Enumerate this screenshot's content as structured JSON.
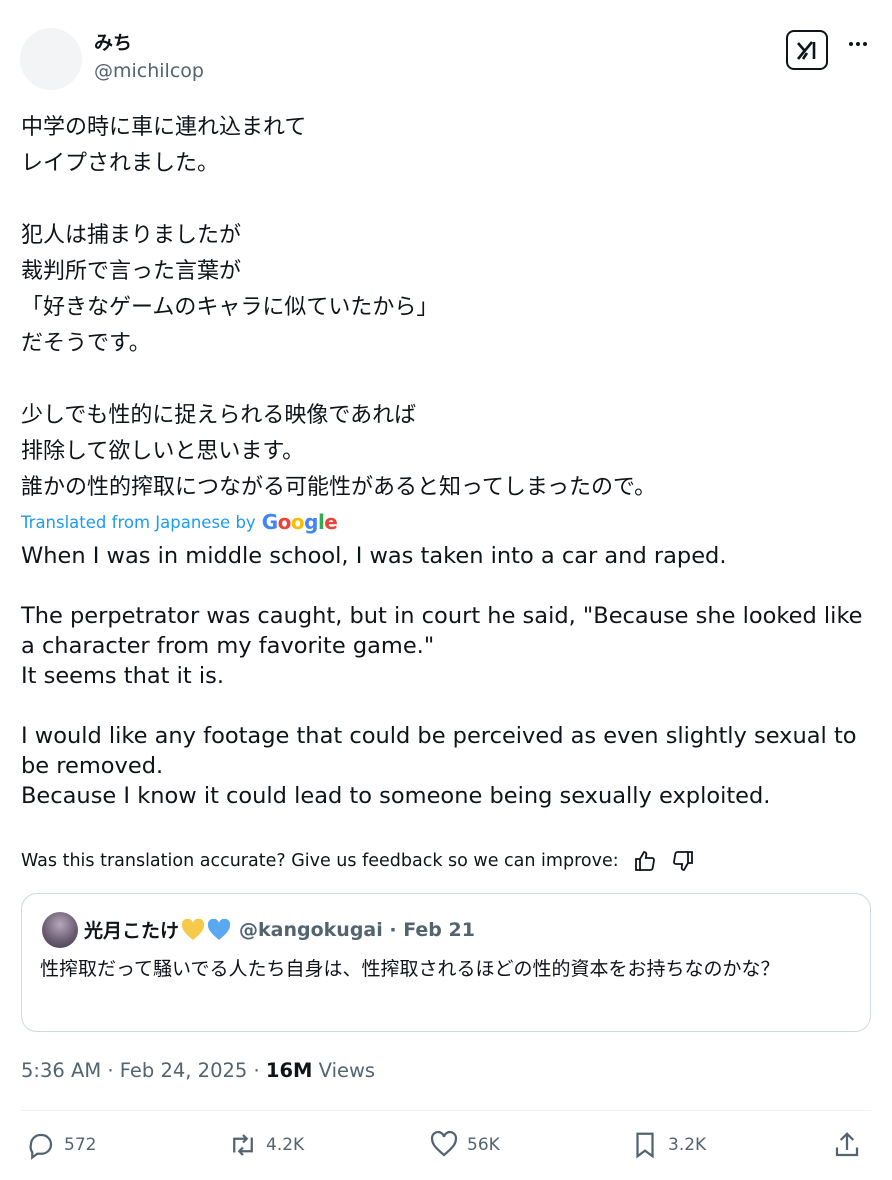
{
  "author": {
    "name": "みち",
    "handle": "@michilcop"
  },
  "icons": {
    "grok": "grok-icon",
    "more": "more-icon"
  },
  "tweet": {
    "jp_text": "中学の時に車に連れ込まれて\nレイプされました。\n\n犯人は捕まりましたが\n裁判所で言った言葉が\n「好きなゲームのキャラに似ていたから」\nだそうです。\n\n少しでも性的に捉えられる映像であれば\n排除して欲しいと思います。\n誰かの性的搾取につながる可能性があると知ってしまったので。",
    "translated_label": "Translated from Japanese by",
    "translator": "Google",
    "en_text": "When I was in middle school, I was taken into a car and raped.\n\nThe perpetrator was caught, but in court he said, \"Because she looked like a character from my favorite game.\"\nIt seems that it is.\n\nI would like any footage that could be perceived as even slightly sexual to be removed.\nBecause I know it could lead to someone being sexually exploited.",
    "feedback": "Was this translation accurate? Give us feedback so we can improve:"
  },
  "quote": {
    "name": "光月こたけ",
    "handle": "@kangokugai · Feb 21",
    "text": "性搾取だって騒いでる人たち自身は、性搾取されるほどの性的資本をお持ちなのかな？",
    "heart_colors": [
      "#f7c948",
      "#5aa9f0"
    ]
  },
  "meta": {
    "time": "5:36 AM · Feb 24, 2025 · ",
    "views_count": "16M",
    "views_label": " Views"
  },
  "actions": {
    "replies": "572",
    "reposts": "4.2K",
    "likes": "56K",
    "bookmarks": "3.2K"
  },
  "colors": {
    "accent": "#1d9bf0",
    "muted": "#536471"
  }
}
